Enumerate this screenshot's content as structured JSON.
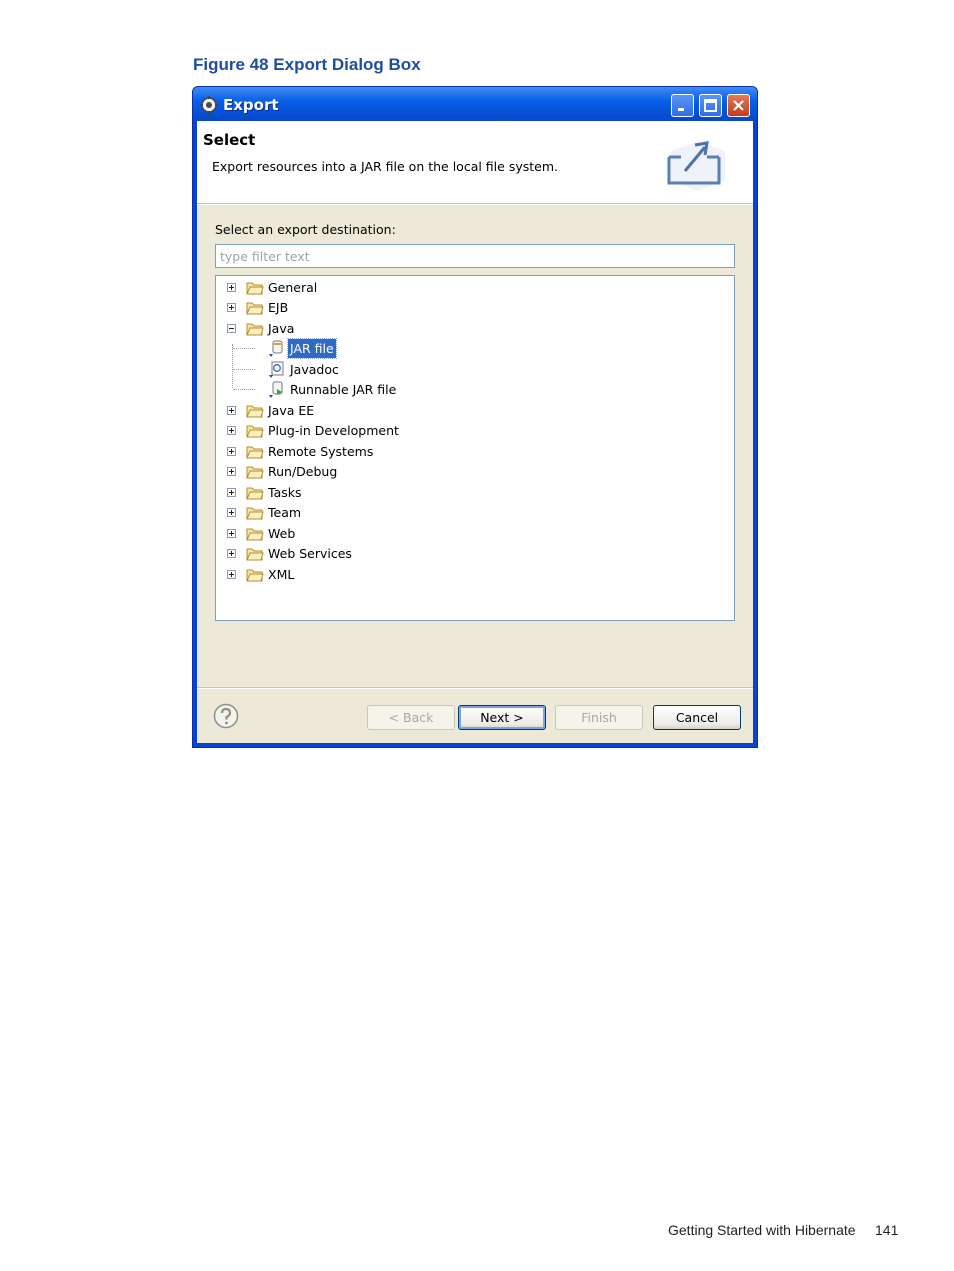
{
  "figure_caption": "Figure 48 Export Dialog Box",
  "dialog": {
    "title": "Export",
    "banner": {
      "title": "Select",
      "description": "Export resources into a JAR file on the local file system."
    },
    "destination_label": "Select an export destination:",
    "filter_placeholder": "type filter text",
    "tree": {
      "items": [
        {
          "label": "General",
          "expanded": false
        },
        {
          "label": "EJB",
          "expanded": false
        },
        {
          "label": "Java",
          "expanded": true,
          "children": [
            {
              "label": "JAR file",
              "selected": true,
              "icon": "jar-icon"
            },
            {
              "label": "Javadoc",
              "icon": "javadoc-icon"
            },
            {
              "label": "Runnable JAR file",
              "icon": "runnable-jar-icon"
            }
          ]
        },
        {
          "label": "Java EE",
          "expanded": false
        },
        {
          "label": "Plug-in Development",
          "expanded": false
        },
        {
          "label": "Remote Systems",
          "expanded": false
        },
        {
          "label": "Run/Debug",
          "expanded": false
        },
        {
          "label": "Tasks",
          "expanded": false
        },
        {
          "label": "Team",
          "expanded": false
        },
        {
          "label": "Web",
          "expanded": false
        },
        {
          "label": "Web Services",
          "expanded": false
        },
        {
          "label": "XML",
          "expanded": false
        }
      ]
    },
    "buttons": {
      "back": "< Back",
      "next": "Next >",
      "finish": "Finish",
      "cancel": "Cancel"
    }
  },
  "page_footer": {
    "text": "Getting Started with Hibernate",
    "page_number": "141"
  },
  "colors": {
    "caption": "#1d4f9c",
    "titlebar": "#0a5fe8",
    "selection": "#316ac5",
    "dialog_face": "#ece9d8"
  }
}
